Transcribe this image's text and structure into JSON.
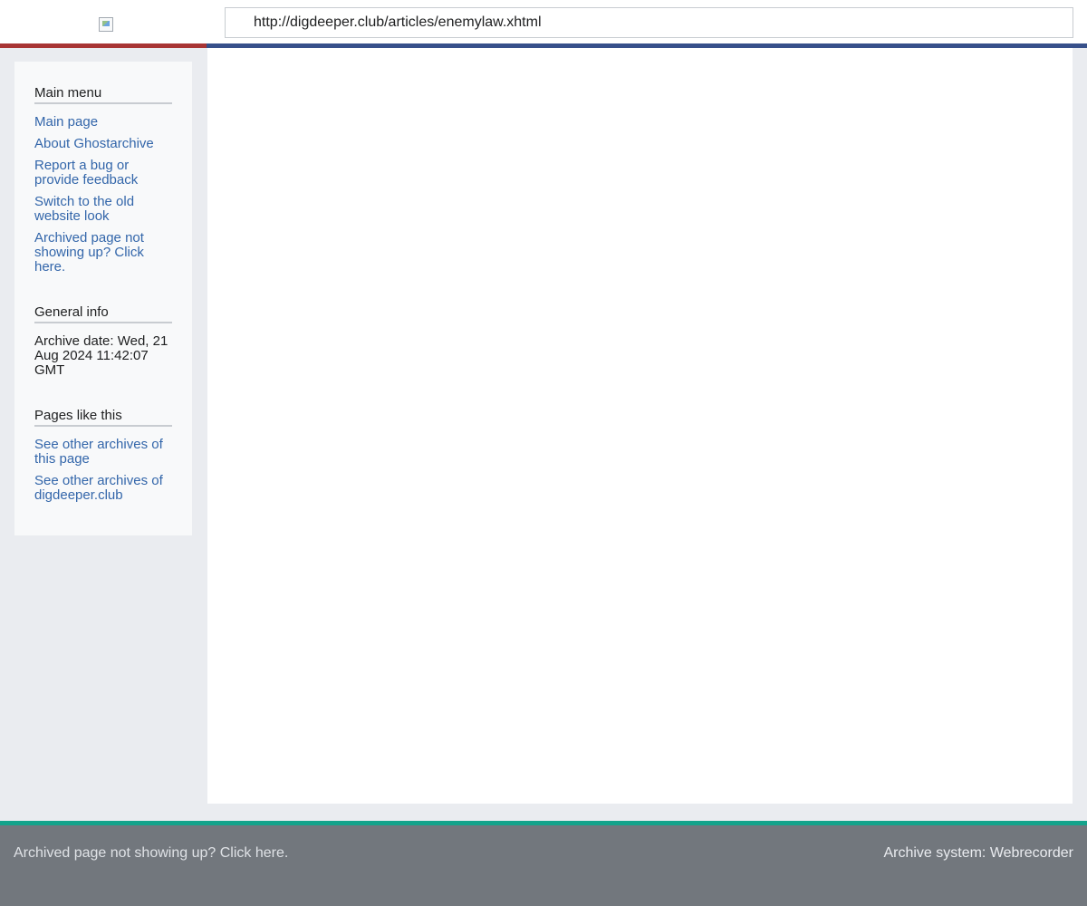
{
  "header": {
    "logo_icon": "broken-image-icon",
    "url": "http://digdeeper.club/articles/enemylaw.xhtml"
  },
  "sidebar": {
    "main_menu": {
      "title": "Main menu",
      "items": [
        {
          "label": "Main page"
        },
        {
          "label": "About Ghostarchive"
        },
        {
          "label": "Report a bug or provide feedback"
        },
        {
          "label": "Switch to the old website look"
        },
        {
          "label": "Archived page not showing up? Click here."
        }
      ]
    },
    "general_info": {
      "title": "General info",
      "archive_date": "Archive date: Wed, 21 Aug 2024 11:42:07 GMT"
    },
    "pages_like_this": {
      "title": "Pages like this",
      "items": [
        {
          "label": "See other archives of this page"
        },
        {
          "label": "See other archives of digdeeper.club"
        }
      ]
    }
  },
  "footer": {
    "left_link": "Archived page not showing up? Click here.",
    "right_text": "Archive system: Webrecorder"
  },
  "colors": {
    "accent_red": "#a83434",
    "accent_blue": "#37508a",
    "accent_teal": "#14a38b",
    "link": "#3366aa",
    "footer_bg": "#72777d"
  }
}
